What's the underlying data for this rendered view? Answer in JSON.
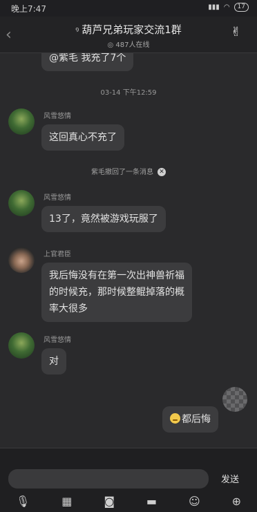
{
  "status_bar": {
    "time": "晚上7:47",
    "battery": "17"
  },
  "header": {
    "title": "葫芦兄弟玩家交流1群",
    "online": "487人在线"
  },
  "messages": {
    "partial_top": "@紫毛 我充了7个",
    "timestamp": "03-14 下午12:59",
    "m1": {
      "sender": "风雪悠情",
      "text": "这回真心不充了"
    },
    "recall_notice": "紫毛撤回了一条消息",
    "m2": {
      "sender": "风雪悠情",
      "text": "13了，竟然被游戏玩服了"
    },
    "m3": {
      "sender": "上官君臣",
      "line1": "我后悔没有在第一次出神兽祈福",
      "line2": "的时候充，那时候整鲲掉落的概",
      "line3": "率大很多"
    },
    "m4": {
      "sender": "风雪悠情",
      "text": "对"
    },
    "me": {
      "text": "都后悔"
    }
  },
  "input": {
    "send_label": "发送"
  },
  "icons": {
    "mic": "mic-icon",
    "picture": "picture-icon",
    "camera": "camera-icon",
    "folder": "folder-icon",
    "emoji": "emoji-icon",
    "plus": "plus-icon"
  }
}
